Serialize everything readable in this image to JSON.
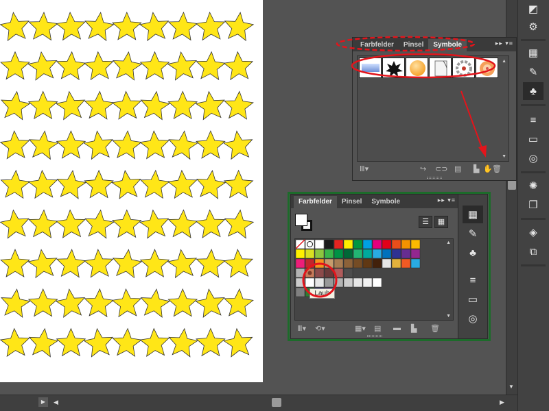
{
  "symbols_panel": {
    "tabs": [
      "Farbfelder",
      "Pinsel",
      "Symbole"
    ],
    "active_tab": "Symbole",
    "menu_glyph": "▸▸",
    "tiles": [
      "gradient-swatch",
      "ink-splat",
      "orange-ball",
      "paper-curl",
      "flower-wreath",
      "orange-blossom"
    ]
  },
  "swatches_panel": {
    "tabs": [
      "Farbfelder",
      "Pinsel",
      "Symbole"
    ],
    "active_tab": "Farbfelder",
    "menu_glyph": "▸▸",
    "tooltip": "Laub",
    "swatch_rows": [
      [
        "none",
        "registration",
        "#ffffff",
        "#1a1a1a",
        "#e52421",
        "#ffed00",
        "#009640",
        "#00a0e3",
        "#e4007d",
        "#e2001a",
        "#e94e1b",
        "#f39200",
        "#fbba00"
      ],
      [
        "#fff000",
        "#d9e021",
        "#8cc63f",
        "#39b54a",
        "#009245",
        "#006837",
        "#22b573",
        "#00a99d",
        "#29abe2",
        "#0071bc",
        "#2e3192",
        "#662d91",
        "#93278f"
      ],
      [
        "#ed1e79",
        "#c1272d",
        "#f7931e",
        "#c69c6d",
        "#a67c52",
        "#8c6239",
        "#754c24",
        "#603813",
        "#42210b",
        "#e6e6e6",
        "gold-gradient",
        "#f15a24",
        "#29abe2"
      ],
      [
        "#b3b3b3",
        "pattern-laub",
        "#8c4a4a",
        "#6b3a3a",
        "#b05c5c",
        "#4d4d4d"
      ],
      [
        "#cccccc",
        "#ffffff",
        "#e6e6e6",
        "#999999",
        "#b3b3b3",
        "#cccccc",
        "#e6e6e6",
        "#f2f2f2",
        "#ffffff"
      ],
      [
        "#808080",
        "#2e7d32",
        "#2e3192",
        "#662d91"
      ]
    ]
  },
  "colors": {
    "ui_bg": "#535353",
    "star_fill": "#ffe617",
    "annotation_red": "#e3141b",
    "panel_highlight_green": "#1c6b2a"
  },
  "artboard": {
    "star_rows": 9,
    "star_cols": 9
  },
  "icons": {
    "toolstrip": [
      "color-icon",
      "color-guide-icon",
      "swatches-icon",
      "brushes-icon",
      "symbols-icon",
      "stroke-icon",
      "gradient-icon",
      "transparency-icon",
      "appearance-icon",
      "graphic-styles-icon",
      "layers-icon",
      "artboards-icon"
    ],
    "sym_bottom": [
      "symbol-library-icon",
      "place-symbol-icon",
      "break-link-icon",
      "symbol-options-icon",
      "new-symbol-icon",
      "delete-symbol-icon"
    ],
    "sw_bottom": [
      "swatch-library-icon",
      "swatch-kinds-icon",
      "swatch-options-icon",
      "new-color-group-icon",
      "new-swatch-icon",
      "delete-swatch-icon"
    ]
  }
}
